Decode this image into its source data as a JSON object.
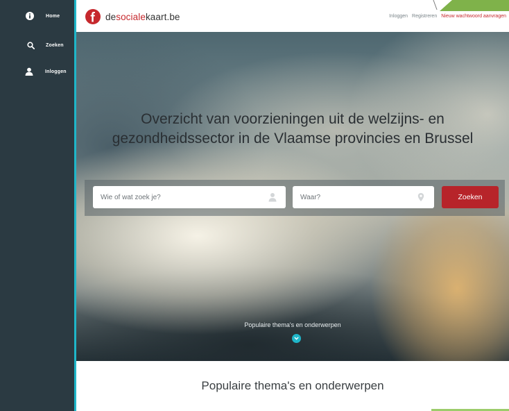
{
  "sidebar": {
    "items": [
      {
        "label": "Home",
        "icon": "info-icon"
      },
      {
        "label": "Zoeken",
        "icon": "search-icon"
      },
      {
        "label": "Inloggen",
        "icon": "user-icon"
      }
    ]
  },
  "header": {
    "logo": {
      "prefix": "de",
      "highlight": "sociale",
      "suffix": "kaart.be"
    },
    "links": {
      "login": "Inloggen",
      "register": "Registreren",
      "forgot_password": "Nieuw wachtwoord aanvragen"
    }
  },
  "hero": {
    "title_line1": "Overzicht van voorzieningen uit de welzijns- en",
    "title_line2": "gezondheidssector in de Vlaamse provincies en Brussel",
    "search": {
      "who_placeholder": "Wie of wat zoek je?",
      "where_placeholder": "Waar?",
      "button_label": "Zoeken"
    },
    "popular_link": "Populaire thema's en onderwerpen"
  },
  "section": {
    "title": "Populaire thema's en onderwerpen"
  },
  "colors": {
    "sidebar_bg": "#2b3a42",
    "accent_teal": "#1fb6c9",
    "brand_red": "#c6282d",
    "button_red": "#b7242a",
    "accent_green": "#7fb24a"
  }
}
